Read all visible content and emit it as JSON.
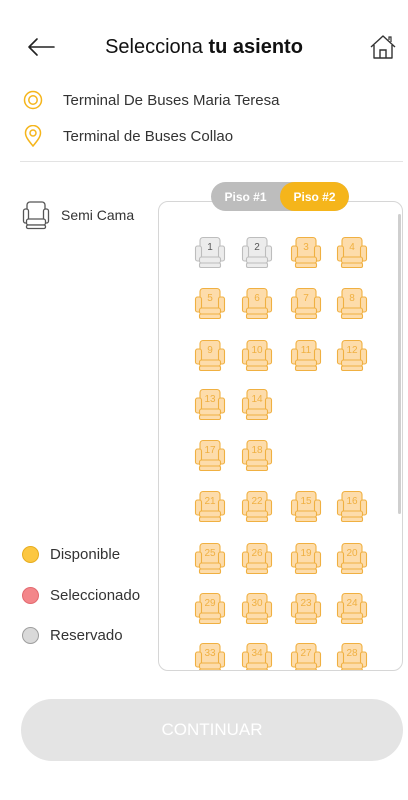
{
  "header": {
    "title_normal": "Selecciona ",
    "title_bold": "tu asiento",
    "back_icon": "arrow-left-icon",
    "home_icon": "home-icon"
  },
  "route": {
    "origin": "Terminal De Buses Maria Teresa",
    "destination": "Terminal de Buses Collao",
    "origin_icon": "origin-target-icon",
    "destination_icon": "location-pin-icon"
  },
  "seat_type": {
    "label": "Semi Cama",
    "icon": "seat-icon"
  },
  "floors": {
    "tabs": [
      "Piso #1",
      "Piso #2"
    ],
    "active_index": 1
  },
  "seats": [
    {
      "num": "1",
      "status": "reserved"
    },
    {
      "num": "2",
      "status": "reserved"
    },
    {
      "num": "3",
      "status": "available"
    },
    {
      "num": "4",
      "status": "available"
    },
    {
      "num": "5",
      "status": "available"
    },
    {
      "num": "6",
      "status": "available"
    },
    {
      "num": "7",
      "status": "available"
    },
    {
      "num": "8",
      "status": "available"
    },
    {
      "num": "9",
      "status": "available"
    },
    {
      "num": "10",
      "status": "available"
    },
    {
      "num": "11",
      "status": "available"
    },
    {
      "num": "12",
      "status": "available"
    },
    {
      "num": "13",
      "status": "available"
    },
    {
      "num": "14",
      "status": "available"
    },
    {
      "num": "17",
      "status": "available"
    },
    {
      "num": "18",
      "status": "available"
    },
    {
      "num": "21",
      "status": "available"
    },
    {
      "num": "22",
      "status": "available"
    },
    {
      "num": "15",
      "status": "available"
    },
    {
      "num": "16",
      "status": "available"
    },
    {
      "num": "25",
      "status": "available"
    },
    {
      "num": "26",
      "status": "available"
    },
    {
      "num": "19",
      "status": "available"
    },
    {
      "num": "20",
      "status": "available"
    },
    {
      "num": "29",
      "status": "available"
    },
    {
      "num": "30",
      "status": "available"
    },
    {
      "num": "23",
      "status": "available"
    },
    {
      "num": "24",
      "status": "available"
    },
    {
      "num": "33",
      "status": "available"
    },
    {
      "num": "34",
      "status": "available"
    },
    {
      "num": "27",
      "status": "available"
    },
    {
      "num": "28",
      "status": "available"
    }
  ],
  "legend": [
    {
      "label": "Disponible",
      "color": "#fcc741"
    },
    {
      "label": "Seleccionado",
      "color": "#f3868a"
    },
    {
      "label": "Reservado",
      "color": "#d9d9d9"
    }
  ],
  "colors": {
    "accent": "#f5b51b",
    "seat_available_fill": "#fddcab",
    "seat_available_stroke": "#f0b041",
    "seat_reserved_fill": "#ececec",
    "seat_reserved_stroke": "#bdbdbd"
  },
  "footer": {
    "continue_label": "CONTINUAR"
  }
}
